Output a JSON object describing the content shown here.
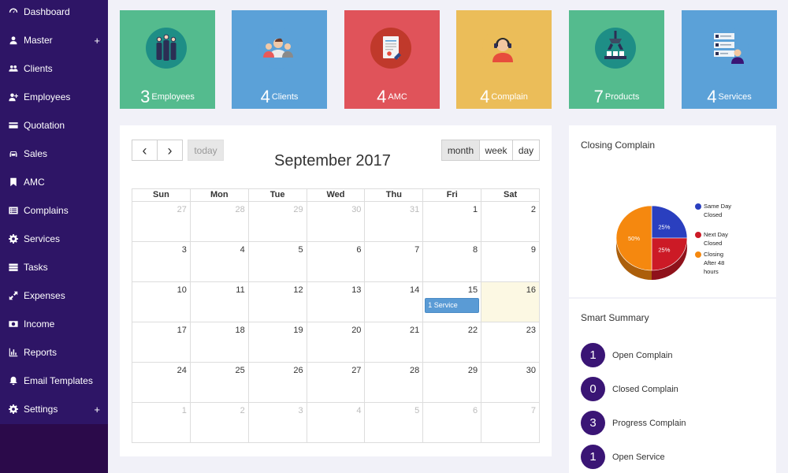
{
  "sidebar": {
    "items": [
      {
        "label": "Dashboard",
        "icon": "dashboard-icon"
      },
      {
        "label": "Master",
        "icon": "user-icon",
        "expand": "+"
      },
      {
        "label": "Clients",
        "icon": "users-icon"
      },
      {
        "label": "Employees",
        "icon": "user-plus-icon"
      },
      {
        "label": "Quotation",
        "icon": "credit-card-icon"
      },
      {
        "label": "Sales",
        "icon": "car-icon"
      },
      {
        "label": "AMC",
        "icon": "bookmark-icon"
      },
      {
        "label": "Complains",
        "icon": "list-alt-icon"
      },
      {
        "label": "Services",
        "icon": "gear-icon"
      },
      {
        "label": "Tasks",
        "icon": "tasks-icon"
      },
      {
        "label": "Expenses",
        "icon": "expand-icon"
      },
      {
        "label": "Income",
        "icon": "money-icon"
      },
      {
        "label": "Reports",
        "icon": "bar-chart-icon"
      },
      {
        "label": "Email Templates",
        "icon": "bell-icon"
      },
      {
        "label": "Settings",
        "icon": "gear-icon",
        "expand": "+"
      }
    ]
  },
  "tiles": [
    {
      "count": "3",
      "label": "Employees",
      "color": "#54bb8e",
      "icon": "employees-icon"
    },
    {
      "count": "4",
      "label": "Clients",
      "color": "#5ba1d8",
      "icon": "clients-icon"
    },
    {
      "count": "4",
      "label": "AMC",
      "color": "#e0535a",
      "icon": "amc-icon"
    },
    {
      "count": "4",
      "label": "Complain",
      "color": "#ebbd59",
      "icon": "complain-icon"
    },
    {
      "count": "7",
      "label": "Products",
      "color": "#54bb8e",
      "icon": "products-icon"
    },
    {
      "count": "4",
      "label": "Services",
      "color": "#5ba1d8",
      "icon": "services-icon"
    }
  ],
  "calendar": {
    "title": "September 2017",
    "prev_icon": "‹",
    "next_icon": "›",
    "today_label": "today",
    "views": [
      "month",
      "week",
      "day"
    ],
    "active_view": "month",
    "weekdays": [
      "Sun",
      "Mon",
      "Tue",
      "Wed",
      "Thu",
      "Fri",
      "Sat"
    ],
    "weeks": [
      [
        "27",
        "28",
        "29",
        "30",
        "31",
        "1",
        "2"
      ],
      [
        "3",
        "4",
        "5",
        "6",
        "7",
        "8",
        "9"
      ],
      [
        "10",
        "11",
        "12",
        "13",
        "14",
        "15",
        "16"
      ],
      [
        "17",
        "18",
        "19",
        "20",
        "21",
        "22",
        "23"
      ],
      [
        "24",
        "25",
        "26",
        "27",
        "28",
        "29",
        "30"
      ],
      [
        "1",
        "2",
        "3",
        "4",
        "5",
        "6",
        "7"
      ]
    ],
    "today_date": "16",
    "event": {
      "date": "15",
      "label": "1 Service"
    }
  },
  "closing_complain": {
    "title": "Closing Complain",
    "chart_data": {
      "type": "pie",
      "slices": [
        {
          "label": "Same Day Closed",
          "value": 25,
          "text": "25%",
          "color": "#2a3fbf"
        },
        {
          "label": "Next Day Closed",
          "value": 25,
          "text": "25%",
          "color": "#cc1a26"
        },
        {
          "label": "Closing After 48 hours",
          "value": 50,
          "text": "50%",
          "color": "#f5880f"
        }
      ],
      "legend": "right"
    }
  },
  "smart_summary": {
    "title": "Smart Summary",
    "items": [
      {
        "value": "1",
        "label": "Open Complain"
      },
      {
        "value": "0",
        "label": "Closed Complain"
      },
      {
        "value": "3",
        "label": "Progress Complain"
      },
      {
        "value": "1",
        "label": "Open Service"
      }
    ]
  }
}
